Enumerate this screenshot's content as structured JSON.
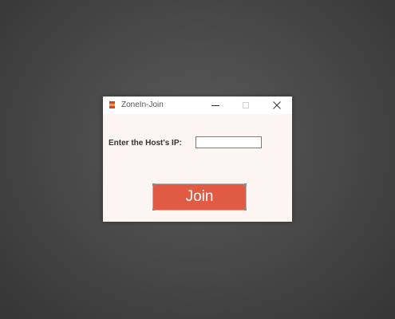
{
  "window": {
    "title": "ZoneIn-Join",
    "controls": {
      "minimize_icon": "minimize-icon",
      "maximize_icon": "maximize-icon",
      "close_icon": "close-icon"
    }
  },
  "form": {
    "ip_label": "Enter the Host's IP:",
    "ip_value": "",
    "ip_placeholder": ""
  },
  "join_button": {
    "label": "Join"
  },
  "colors": {
    "desktop_background": "#4a4a4a",
    "window_background": "#fdf5f1",
    "titlebar_background": "#ffffff",
    "join_button": "#e05a44",
    "join_text": "#ffffff",
    "app_icon_red": "#d9432f",
    "app_icon_orange": "#f39a3c"
  }
}
